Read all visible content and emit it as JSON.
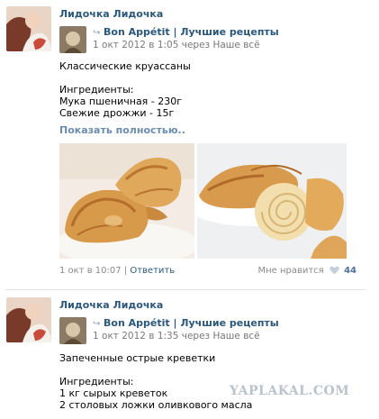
{
  "posts": [
    {
      "author": "Лидочка Лидочка",
      "group": "Bon Appétit",
      "group_sep": "|",
      "group_tagline": "Лучшие рецепты",
      "repost_meta": "1 окт 2012 в 1:05",
      "repost_via": "через Наше всё",
      "text": "Классические круассаны\n\nИнгредиенты:\nМука пшеничная - 230г\nСвежие дрожжи - 15г",
      "show_more": "Показать полностью..",
      "footer_date": "1 окт в 10:07",
      "footer_sep": "|",
      "reply_label": "Ответить",
      "like_label": "Мне нравится",
      "like_count": "44"
    },
    {
      "author": "Лидочка Лидочка",
      "group": "Bon Appétit",
      "group_sep": "|",
      "group_tagline": "Лучшие рецепты",
      "repost_meta": "1 окт 2012 в 1:35",
      "repost_via": "через Наше всё",
      "text": "Запеченные острые креветки\n\nИнгредиенты:\n1 кг сырых креветок\n2 столовых ложки оливкового масла"
    }
  ],
  "watermark": "YAPLAKAL.COM",
  "colors": {
    "link": "#2b587a",
    "muted": "#7a7a7a",
    "heart": "#c5cfd9"
  },
  "icons": {
    "repost": "repost-arrow-icon",
    "like": "heart-icon"
  }
}
